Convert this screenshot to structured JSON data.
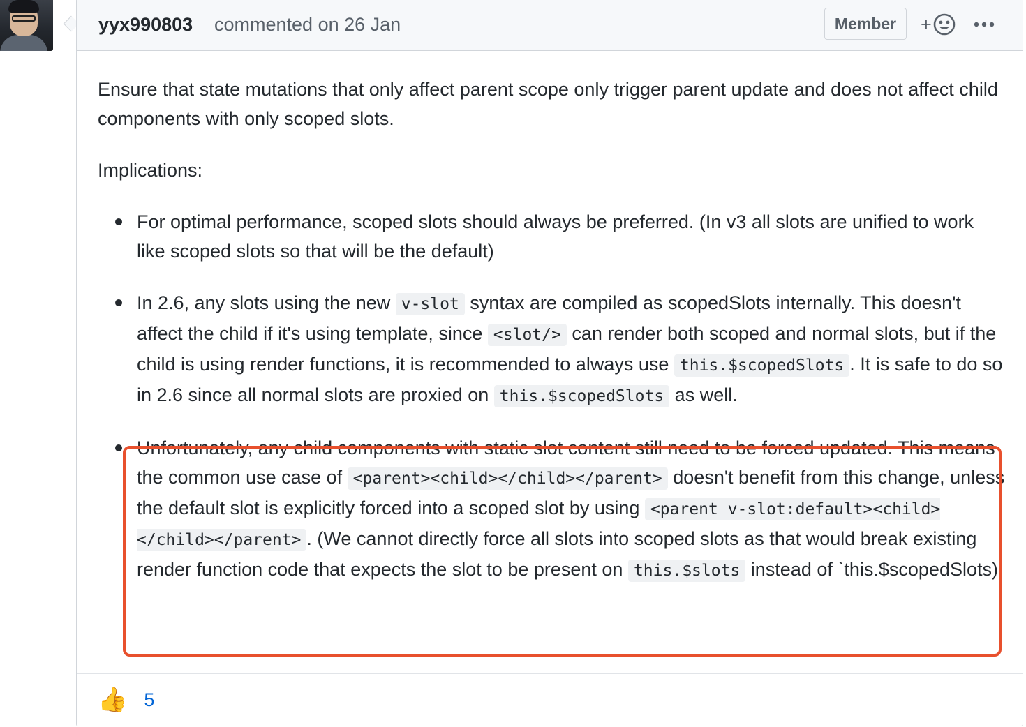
{
  "comment": {
    "author": "yyx990803",
    "meta": "commented on 26 Jan",
    "badge": "Member",
    "add_reaction_label": "+",
    "paragraphs": [
      "Ensure that state mutations that only affect parent scope only trigger parent update and does not affect child components with only scoped slots.",
      "Implications:"
    ],
    "bullets": [
      {
        "parts": [
          {
            "t": "text",
            "v": "For optimal performance, scoped slots should always be preferred. (In v3 all slots are unified to work like scoped slots so that will be the default)"
          }
        ]
      },
      {
        "parts": [
          {
            "t": "text",
            "v": "In 2.6, any slots using the new "
          },
          {
            "t": "code",
            "v": "v-slot"
          },
          {
            "t": "text",
            "v": " syntax are compiled as scopedSlots internally. This doesn't affect the child if it's using template, since "
          },
          {
            "t": "code",
            "v": "<slot/>"
          },
          {
            "t": "text",
            "v": " can render both scoped and normal slots, but if the child is using render functions, it is recommended to always use "
          },
          {
            "t": "code",
            "v": "this.$scopedSlots"
          },
          {
            "t": "text",
            "v": ". It is safe to do so in 2.6 since all normal slots are proxied on "
          },
          {
            "t": "code",
            "v": "this.$scopedSlots"
          },
          {
            "t": "text",
            "v": " as well."
          }
        ]
      },
      {
        "parts": [
          {
            "t": "text",
            "v": "Unfortunately, any child components with static slot content still need to be forced updated. This means the common use case of "
          },
          {
            "t": "code",
            "v": "<parent><child></child></parent>"
          },
          {
            "t": "text",
            "v": " doesn't benefit from this change, unless the default slot is explicitly forced into a scoped slot by using "
          },
          {
            "t": "code",
            "v": "<parent v-slot:default><child></child></parent>"
          },
          {
            "t": "text",
            "v": ". (We cannot directly force all slots into scoped slots as that would break existing render function code that expects the slot to be present on "
          },
          {
            "t": "code",
            "v": "this.$slots"
          },
          {
            "t": "text",
            "v": " instead of `this.$scopedSlots)"
          }
        ]
      }
    ],
    "reactions": [
      {
        "emoji": "👍",
        "count": "5"
      }
    ]
  },
  "colors": {
    "highlight_border": "#e8502d",
    "link_blue": "#0366d6",
    "header_bg": "#f6f8fa"
  }
}
